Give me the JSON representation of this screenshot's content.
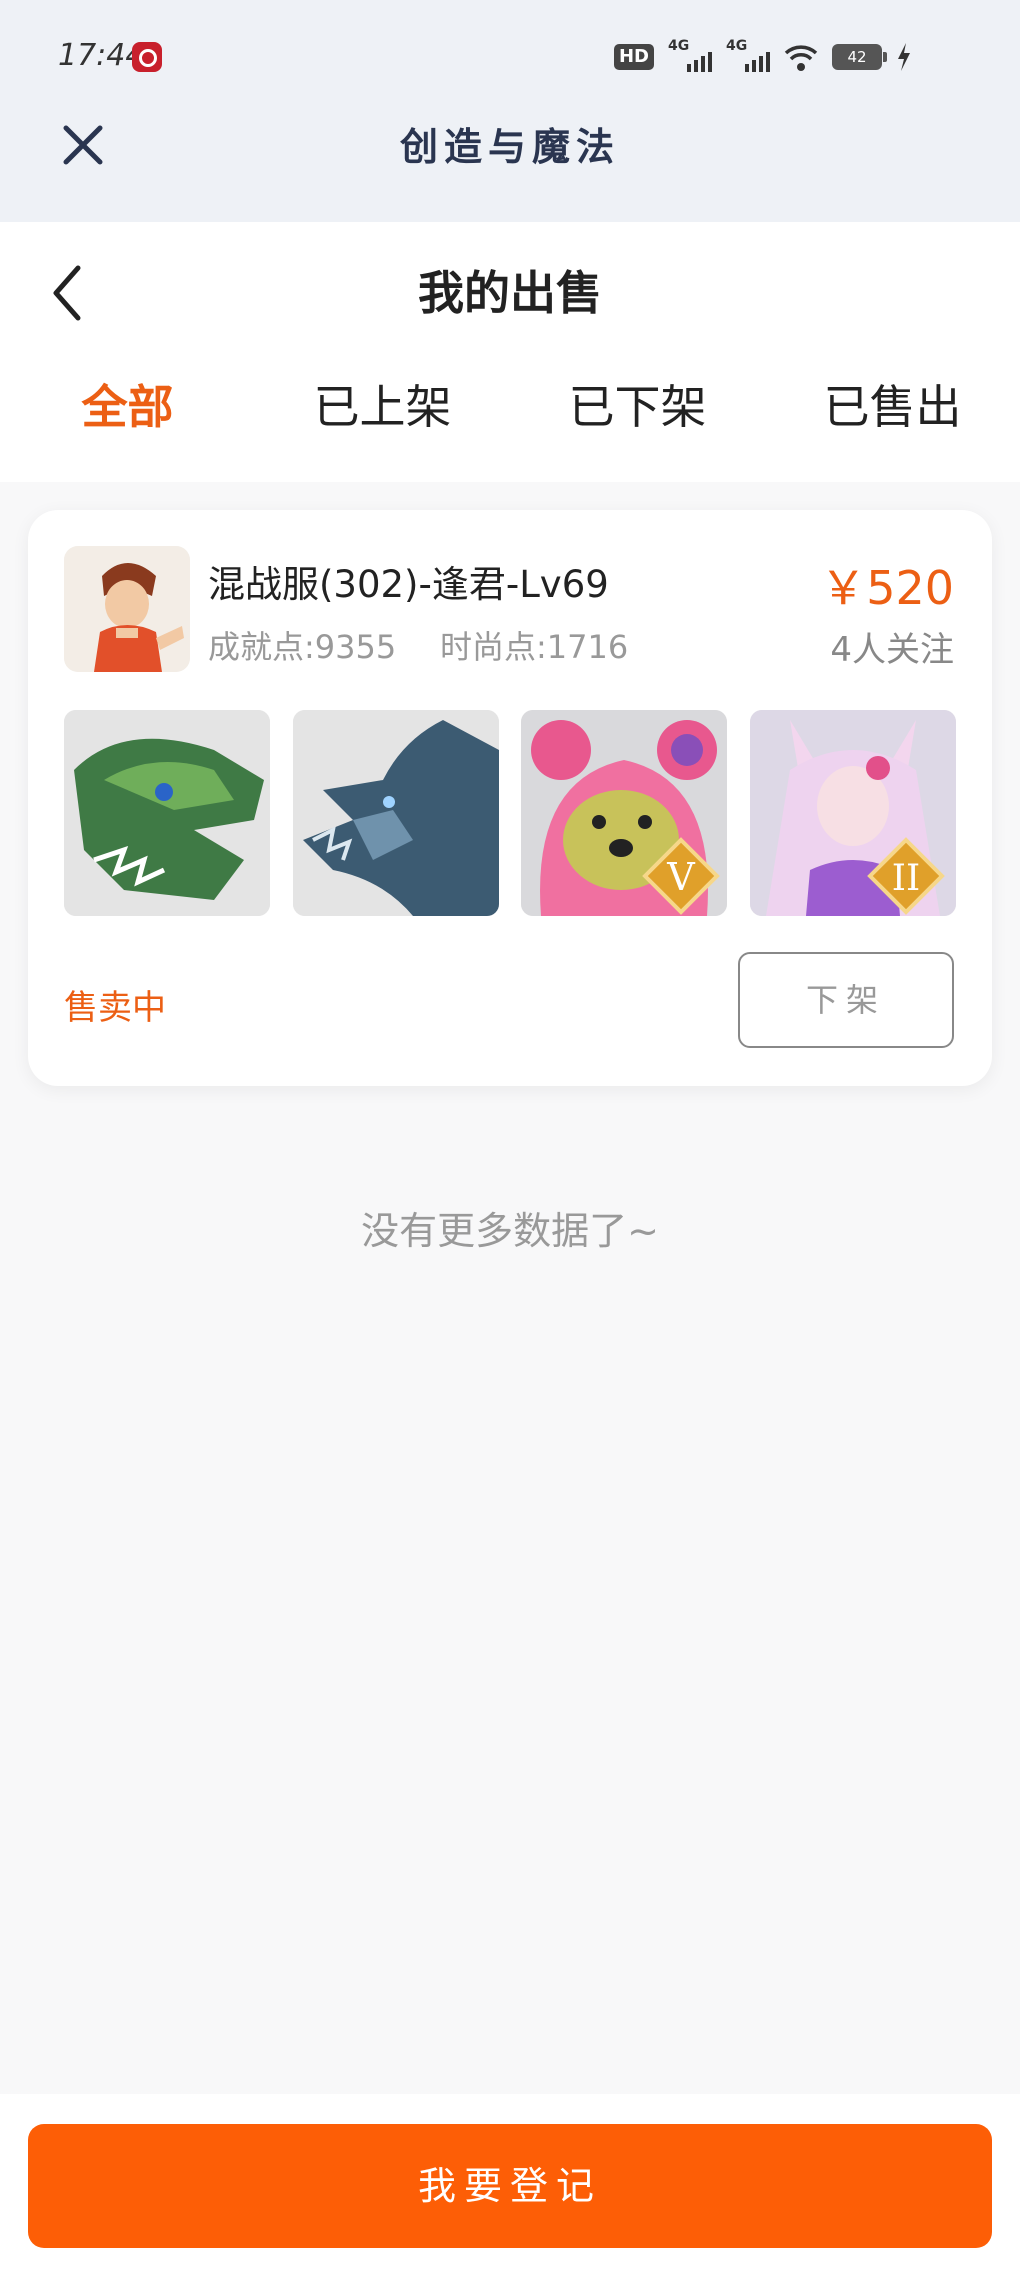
{
  "status_bar": {
    "time": "17:44",
    "hd_label": "HD",
    "signal1_label": "4G",
    "signal2_label": "4G",
    "battery": "42"
  },
  "app_header": {
    "title": "创造与魔法"
  },
  "page": {
    "title": "我的出售"
  },
  "tabs": [
    {
      "label": "全部",
      "active": true
    },
    {
      "label": "已上架",
      "active": false
    },
    {
      "label": "已下架",
      "active": false
    },
    {
      "label": "已售出",
      "active": false
    }
  ],
  "listings": [
    {
      "title": "混战服(302)-逢君-Lv69",
      "achievement": "成就点:9355",
      "fashion": "时尚点:1716",
      "price": "￥520",
      "followers": "4人关注",
      "status": "售卖中",
      "action_label": "下架",
      "thumbnails": [
        {
          "name": "green-dragon",
          "badge": ""
        },
        {
          "name": "blue-dragon",
          "badge": ""
        },
        {
          "name": "pink-bear",
          "badge": "V"
        },
        {
          "name": "fox-girl",
          "badge": "II"
        }
      ]
    }
  ],
  "footer": {
    "no_more": "没有更多数据了~",
    "register_label": "我要登记"
  },
  "colors": {
    "accent": "#ec5f14",
    "button": "#fd5e06",
    "header_bg": "#eef1f6"
  }
}
